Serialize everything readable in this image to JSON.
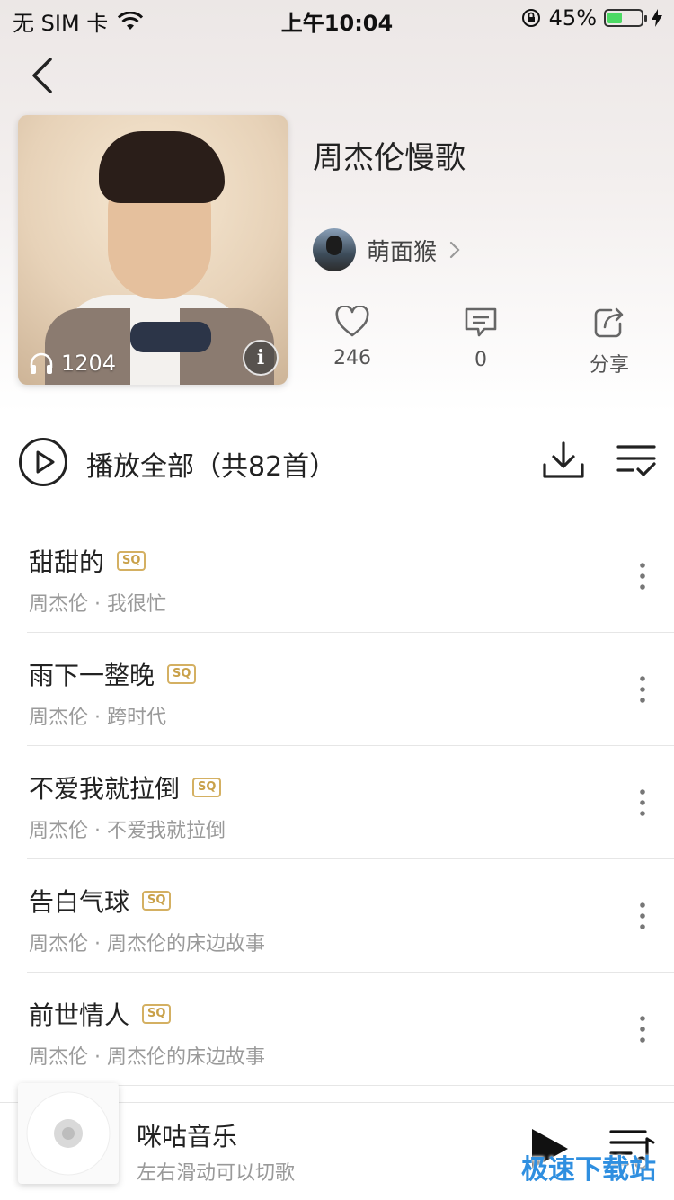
{
  "status_bar": {
    "carrier": "无 SIM 卡",
    "time": "上午10:04",
    "battery": "45%",
    "battery_level": 0.45,
    "battery_color": "#4cd964"
  },
  "header": {
    "back_icon": "chevron-left-icon"
  },
  "playlist": {
    "title": "周杰伦慢歌",
    "play_count": "1204",
    "creator": "萌面猴"
  },
  "actions": {
    "like_count": "246",
    "comment_count": "0",
    "share_label": "分享"
  },
  "play_all": {
    "label": "播放全部（共82首）"
  },
  "songs": [
    {
      "title": "甜甜的",
      "badge": "SQ",
      "subtitle": "周杰伦 · 我很忙"
    },
    {
      "title": "雨下一整晚",
      "badge": "SQ",
      "subtitle": "周杰伦 · 跨时代"
    },
    {
      "title": "不爱我就拉倒",
      "badge": "SQ",
      "subtitle": "周杰伦 · 不爱我就拉倒"
    },
    {
      "title": "告白气球",
      "badge": "SQ",
      "subtitle": "周杰伦 · 周杰伦的床边故事"
    },
    {
      "title": "前世情人",
      "badge": "SQ",
      "subtitle": "周杰伦 · 周杰伦的床边故事"
    }
  ],
  "mini_player": {
    "title": "咪咕音乐",
    "subtitle": "左右滑动可以切歌"
  },
  "watermark": "极速下载站",
  "colors": {
    "sq_badge": "#c9a14a",
    "watermark": "#2f8fe0"
  }
}
